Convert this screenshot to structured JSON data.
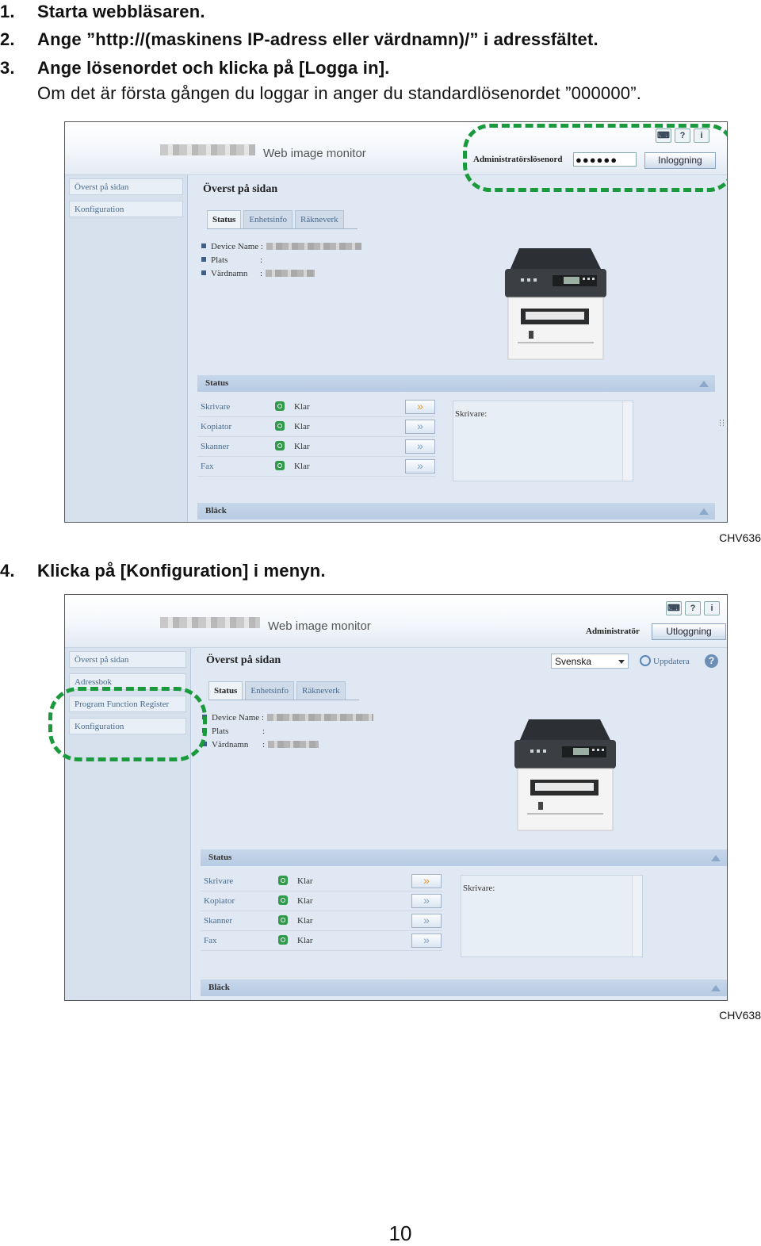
{
  "steps": [
    {
      "num": "1.",
      "text": "Starta webbläsaren."
    },
    {
      "num": "2.",
      "text": "Ange ”http://(maskinens IP-adress eller värdnamn)/” i adressfältet."
    },
    {
      "num": "3.",
      "text": "Ange lösenordet och klicka på [Logga in]."
    },
    {
      "num": "4.",
      "text": "Klicka på [Konfiguration] i menyn."
    }
  ],
  "step3_note": "Om det är första gången du loggar in anger du standardlösenordet ”000000”.",
  "shot1": {
    "code": "CHV636",
    "header_title": "Web image monitor",
    "tool_icons": [
      "keyboard-icon",
      "help-icon",
      "info-icon"
    ],
    "tool_glyphs": [
      "⌨",
      "?",
      "i"
    ],
    "login_label": "Administratörslösenord",
    "password_value": "●●●●●●",
    "login_button": "Inloggning",
    "sidebar": [
      "Överst på sidan",
      "Konfiguration"
    ],
    "page_title": "Överst på sidan",
    "tabs": [
      "Status",
      "Enhetsinfo",
      "Räkneverk"
    ],
    "info_labels": [
      "Device Name :",
      "Plats",
      "Värdnamn"
    ],
    "info_sep": ":",
    "status_section": "Status",
    "status_rows": [
      {
        "name": "Skrivare",
        "state": "Klar"
      },
      {
        "name": "Kopiator",
        "state": "Klar"
      },
      {
        "name": "Skanner",
        "state": "Klar"
      },
      {
        "name": "Fax",
        "state": "Klar"
      }
    ],
    "arrow": "»",
    "panel_text": "Skrivare:",
    "ink_section": "Bläck"
  },
  "shot2": {
    "code": "CHV638",
    "header_title": "Web image monitor",
    "tool_icons": [
      "keyboard-icon",
      "help-icon",
      "info-icon"
    ],
    "tool_glyphs": [
      "⌨",
      "?",
      "i"
    ],
    "user_label": "Administratör",
    "logout_button": "Utloggning",
    "sidebar": [
      "Överst på sidan",
      "Adressbok",
      "Program Function Register",
      "Konfiguration"
    ],
    "page_title": "Överst på sidan",
    "language": "Svenska",
    "refresh": "Uppdatera",
    "help": "?",
    "tabs": [
      "Status",
      "Enhetsinfo",
      "Räkneverk"
    ],
    "info_labels": [
      "Device Name :",
      "Plats",
      "Värdnamn"
    ],
    "info_sep": ":",
    "status_section": "Status",
    "status_rows": [
      {
        "name": "Skrivare",
        "state": "Klar"
      },
      {
        "name": "Kopiator",
        "state": "Klar"
      },
      {
        "name": "Skanner",
        "state": "Klar"
      },
      {
        "name": "Fax",
        "state": "Klar"
      }
    ],
    "arrow": "»",
    "panel_text": "Skrivare:",
    "ink_section": "Bläck"
  },
  "page_number": "10"
}
